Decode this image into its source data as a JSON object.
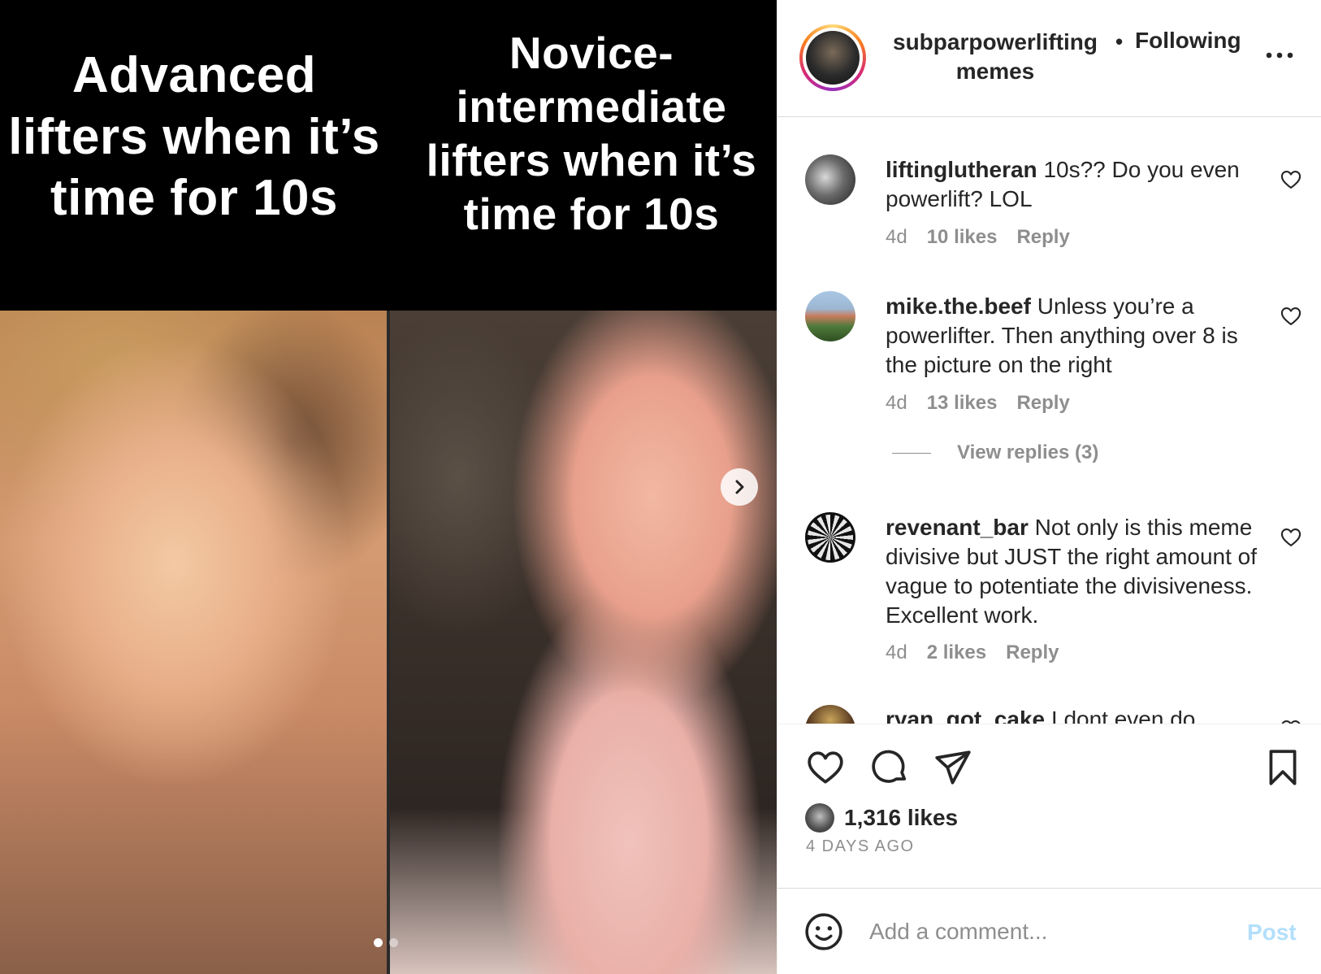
{
  "media": {
    "caption_left": "Advanced lifters when it’s time for 10s",
    "caption_right": "Novice-intermediate lifters when it’s time for 10s",
    "next_icon": "chevron-right-icon",
    "carousel_count": 2,
    "carousel_active": 1
  },
  "header": {
    "username_line1": "subparpowerlifting",
    "username_line2": "memes",
    "separator": "•",
    "follow_status": "Following",
    "more_icon": "more-horizontal-icon"
  },
  "comments": [
    {
      "user": "liftinglutheran",
      "text": "10s?? Do you even powerlift? LOL",
      "age": "4d",
      "likes": "10 likes",
      "reply": "Reply"
    },
    {
      "user": "mike.the.beef",
      "text": "Unless you’re a powerlifter. Then anything over 8 is the picture on the right",
      "age": "4d",
      "likes": "13 likes",
      "reply": "Reply"
    },
    {
      "user": "revenant_bar",
      "text": "Not only is this meme divisive but JUST the right amount of vague to potentiate the divisiveness. Excellent work.",
      "age": "4d",
      "likes": "2 likes",
      "reply": "Reply"
    },
    {
      "user": "ryan_got_cake",
      "text": "I dont even do"
    }
  ],
  "view_replies": "View replies (3)",
  "actions": {
    "icons": [
      "heart-icon",
      "comment-icon",
      "share-icon",
      "bookmark-icon"
    ],
    "likes": "1,316 likes",
    "time_ago": "4 DAYS AGO"
  },
  "add_comment": {
    "placeholder": "Add a comment...",
    "post_label": "Post",
    "emoji_icon": "smiley-icon"
  },
  "colors": {
    "link_blue_disabled": "#b2dffc",
    "secondary_text": "#8e8e8e",
    "primary_text": "#262626"
  }
}
